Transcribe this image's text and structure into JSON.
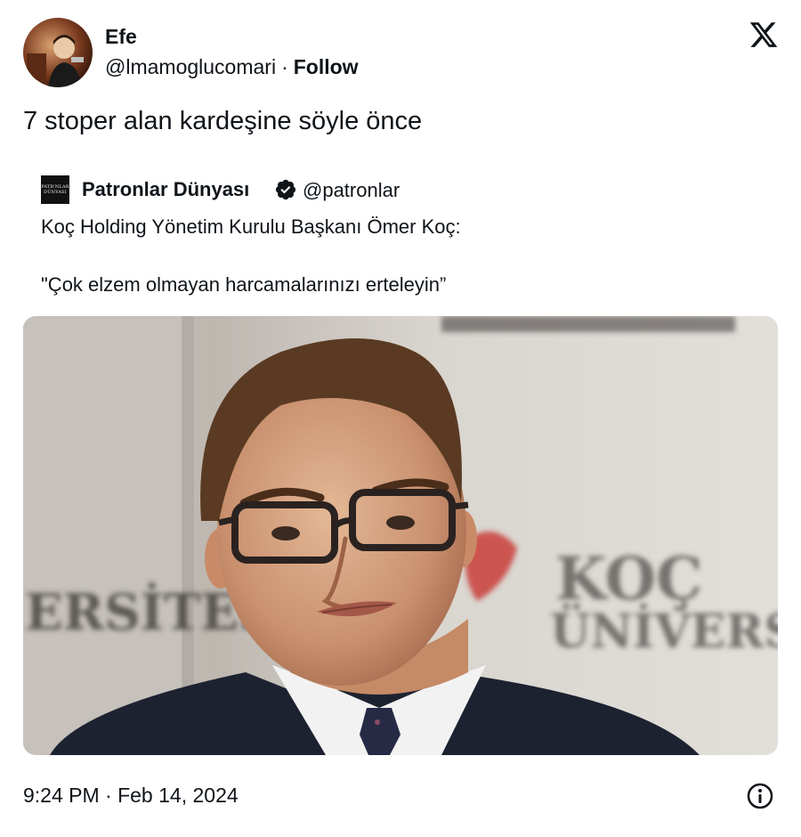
{
  "author": {
    "name": "Efe",
    "handle": "@lmamoglucomari",
    "separator": "·",
    "follow_label": "Follow",
    "avatar_icon": "profile-photo"
  },
  "platform_icon": "x-logo-icon",
  "tweet": {
    "text": "7 stoper alan kardeşine söyle önce"
  },
  "quoted_tweet": {
    "name": "Patronlar Dünyası",
    "handle": "@patronlar",
    "avatar_text": "PATR’NLAR DÜNYASI",
    "verified_icon": "verified-badge-icon",
    "line1": "Koç Holding Yönetim Kurulu Başkanı Ömer Koç:",
    "line2": "\"Çok elzem olmayan harcamalarınızı erteleyin”"
  },
  "photo": {
    "backdrop_text_left": "ERSİTESİ",
    "backdrop_text_right_1": "KOÇ",
    "backdrop_text_right_2": "ÜNİVERSİ"
  },
  "footer": {
    "timestamp": "9:24 PM · Feb 14, 2024",
    "info_icon": "info-icon"
  },
  "colors": {
    "text": "#0f1419",
    "background": "#ffffff",
    "verified": "#0f1419"
  }
}
